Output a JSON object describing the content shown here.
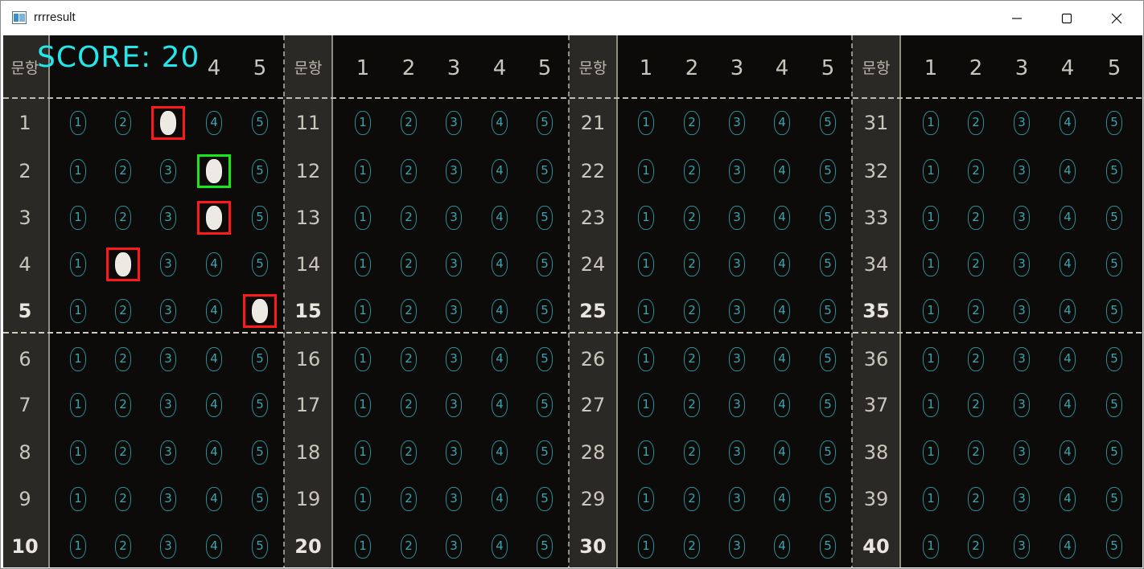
{
  "window": {
    "title": "rrrresult"
  },
  "score_label": "SCORE: 20",
  "header_label": "문항",
  "choice_headers": [
    "1",
    "2",
    "3",
    "4",
    "5"
  ],
  "choices": [
    "1",
    "2",
    "3",
    "4",
    "5"
  ],
  "sections": [
    {
      "start": 1
    },
    {
      "start": 11
    },
    {
      "start": 21
    },
    {
      "start": 31
    }
  ],
  "bold_questions": [
    5,
    10,
    15,
    20,
    25,
    30,
    35,
    40
  ],
  "filled_answers": [
    {
      "question": 1,
      "choice": 3,
      "result": "incorrect"
    },
    {
      "question": 2,
      "choice": 4,
      "result": "correct"
    },
    {
      "question": 3,
      "choice": 4,
      "result": "incorrect"
    },
    {
      "question": 4,
      "choice": 2,
      "result": "incorrect"
    },
    {
      "question": 5,
      "choice": 5,
      "result": "incorrect"
    }
  ],
  "colors": {
    "incorrect": "#ff1a1a",
    "correct": "#17e817",
    "score": "#22e8ec",
    "bubble": "#2f8f97"
  },
  "icons": {
    "app": "app-window-icon",
    "minimize": "minimize-icon",
    "maximize": "maximize-icon",
    "close": "close-icon"
  }
}
